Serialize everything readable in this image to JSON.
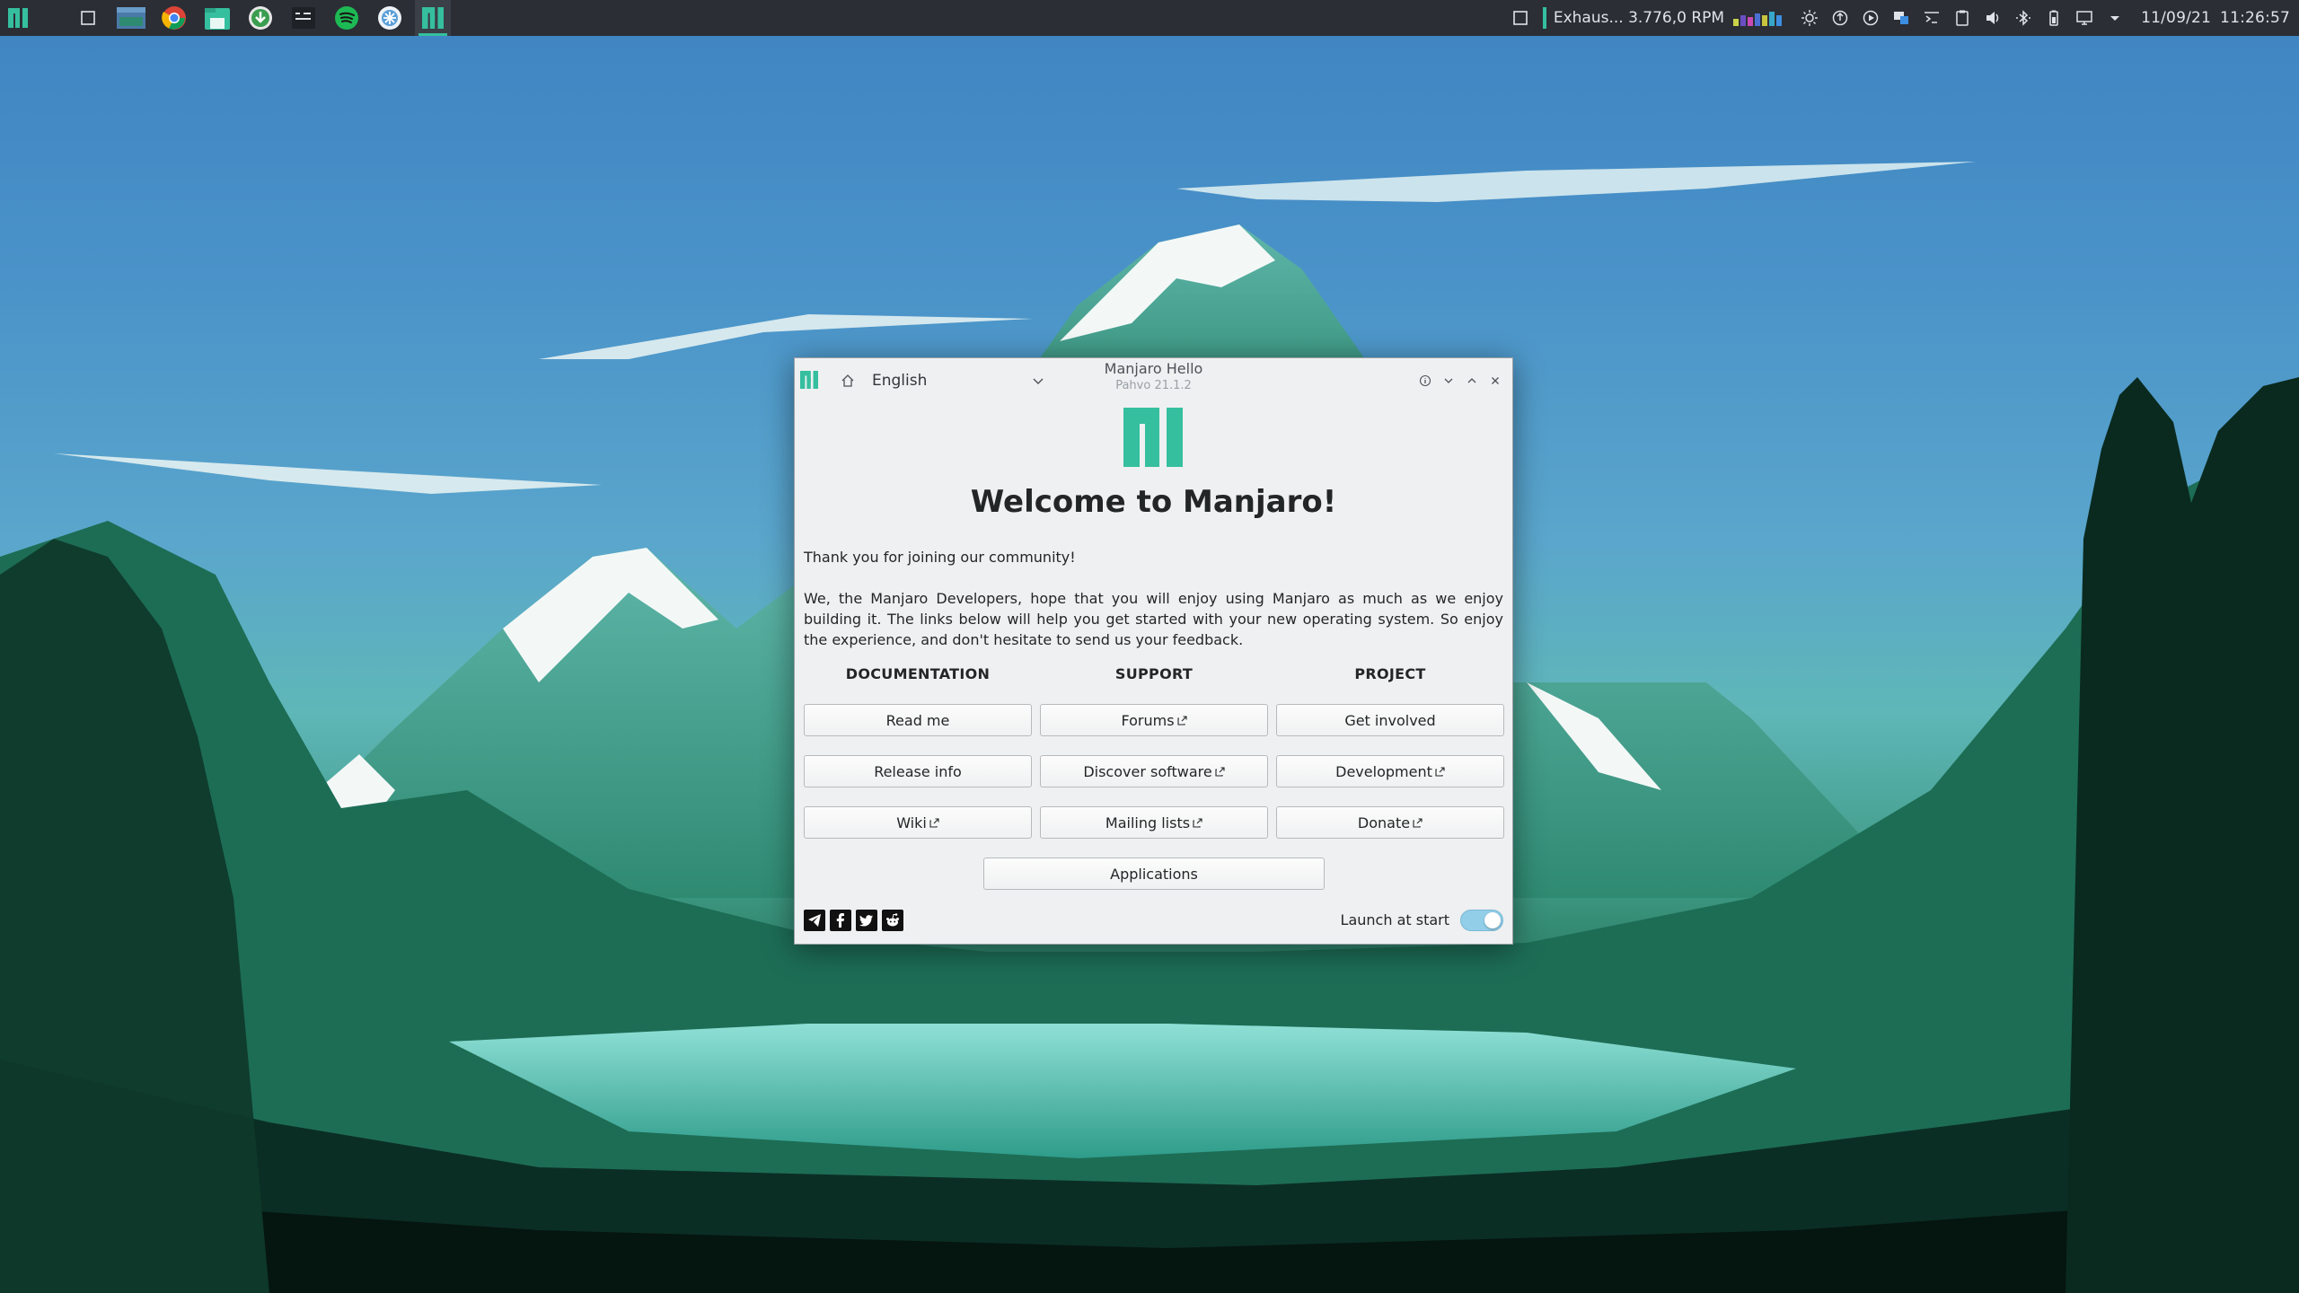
{
  "panel": {
    "sensor_text": "Exhaus...  3.776,0 RPM",
    "date": "11/09/21",
    "time": "11:26:57",
    "accent": "#35bf9f",
    "taskbar": [
      {
        "name": "manjaro-menu-icon"
      },
      {
        "name": "show-desktop-icon"
      },
      {
        "name": "window-thumbnail-icon"
      },
      {
        "name": "chrome-icon"
      },
      {
        "name": "file-manager-icon"
      },
      {
        "name": "download-manager-icon"
      },
      {
        "name": "terminal-icon"
      },
      {
        "name": "spotify-icon"
      },
      {
        "name": "software-center-icon"
      },
      {
        "name": "manjaro-hello-icon"
      }
    ]
  },
  "window": {
    "title": "Manjaro Hello",
    "subtitle": "Pahvo 21.1.2",
    "language": "English",
    "welcome": "Welcome to Manjaro!",
    "intro_1": "Thank you for joining our community!",
    "intro_2": "We, the Manjaro Developers, hope that you will enjoy using Manjaro as much as we enjoy building it. The links below will help you get started with your new operating system. So enjoy the experience, and don't hesitate to send us your feedback.",
    "columns": {
      "documentation": "DOCUMENTATION",
      "support": "SUPPORT",
      "project": "PROJECT"
    },
    "buttons": {
      "read_me": "Read me",
      "release_info": "Release info",
      "wiki": "Wiki",
      "forums": "Forums",
      "discover_software": "Discover software",
      "mailing_lists": "Mailing lists",
      "get_involved": "Get involved",
      "development": "Development",
      "donate": "Donate",
      "applications": "Applications"
    },
    "launch_at_start": "Launch at start",
    "launch_at_start_on": true,
    "brand_color": "#35bf9f"
  }
}
